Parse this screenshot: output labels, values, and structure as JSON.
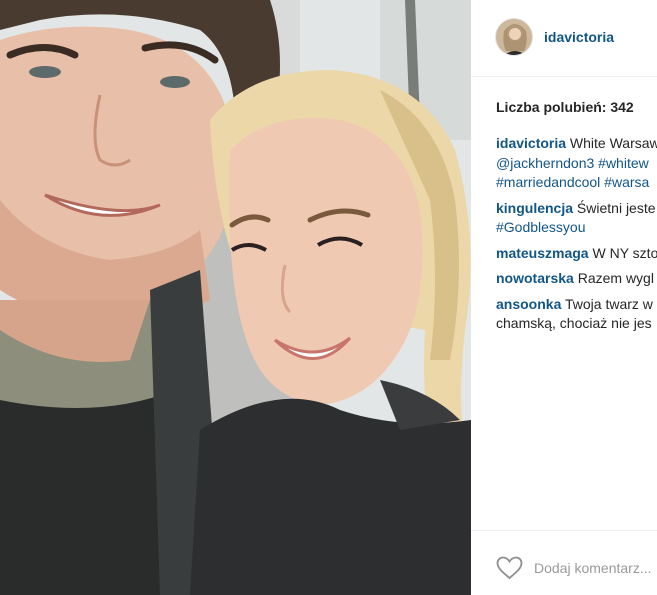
{
  "post": {
    "photo_icon": "selfie-photo",
    "username": "idavictoria",
    "likes_text": "Liczba polubień: 342",
    "add_comment_placeholder": "Dodaj komentarz...",
    "like_icon": "heart-icon"
  },
  "comments": [
    {
      "author": "idavictoria",
      "lines": [
        "White Warsaw",
        "@jackherndon3 #whitew",
        "#marriedandcool #warsa"
      ]
    },
    {
      "author": "kingulencja",
      "lines": [
        "Świetni jeste",
        "#Godblessyou"
      ]
    },
    {
      "author": "mateuszmaga",
      "lines": [
        "W NY szto"
      ]
    },
    {
      "author": "nowotarska",
      "lines": [
        "Razem wygl"
      ]
    },
    {
      "author": "ansoonka",
      "lines": [
        "Twoja twarz w",
        "chamską, chociaż nie jes"
      ]
    }
  ],
  "colors": {
    "link": "#125688",
    "text": "#262626",
    "muted": "#9a9a9a"
  }
}
